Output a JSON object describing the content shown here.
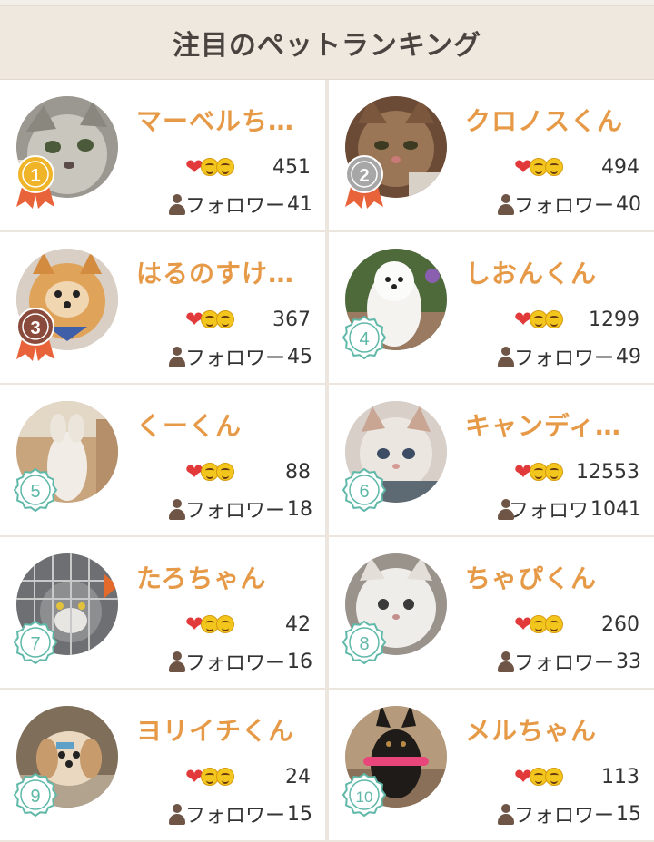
{
  "header": {
    "title": "注目のペットランキング"
  },
  "pets": [
    {
      "rank": "1",
      "name": "マーベルち…",
      "likes": "451",
      "follow_label": "フォロワー",
      "followers": "41",
      "badge": "gold-medal-icon",
      "photo": "gray-tabby-cat"
    },
    {
      "rank": "2",
      "name": "クロノスくん",
      "likes": "494",
      "follow_label": "フォロワー",
      "followers": "40",
      "badge": "silver-medal-icon",
      "photo": "brown-tabby-cat"
    },
    {
      "rank": "3",
      "name": "はるのすけ…",
      "likes": "367",
      "follow_label": "フォロワー",
      "followers": "45",
      "badge": "bronze-medal-icon",
      "photo": "pomeranian-dog"
    },
    {
      "rank": "4",
      "name": "しおんくん",
      "likes": "1299",
      "follow_label": "フォロワー",
      "followers": "49",
      "badge": "rank-seal-icon",
      "photo": "white-spitz-dog"
    },
    {
      "rank": "5",
      "name": "くーくん",
      "likes": "88",
      "follow_label": "フォロワー",
      "followers": "18",
      "badge": "rank-seal-icon",
      "photo": "standing-cat"
    },
    {
      "rank": "6",
      "name": "キャンディ…",
      "likes": "12553",
      "follow_label": "フォロワ",
      "followers": "1041",
      "badge": "rank-seal-icon",
      "photo": "white-kitten"
    },
    {
      "rank": "7",
      "name": "たろちゃん",
      "likes": "42",
      "follow_label": "フォロワー",
      "followers": "16",
      "badge": "rank-seal-icon",
      "photo": "caged-cat"
    },
    {
      "rank": "8",
      "name": "ちゃぴくん",
      "likes": "260",
      "follow_label": "フォロワー",
      "followers": "33",
      "badge": "rank-seal-icon",
      "photo": "fluffy-white-kitten"
    },
    {
      "rank": "9",
      "name": "ヨリイチくん",
      "likes": "24",
      "follow_label": "フォロワー",
      "followers": "15",
      "badge": "rank-seal-icon",
      "photo": "shih-tzu-dog"
    },
    {
      "rank": "10",
      "name": "メルちゃん",
      "likes": "113",
      "follow_label": "フォロワー",
      "followers": "15",
      "badge": "rank-seal-icon",
      "photo": "black-shepherd-puppy"
    }
  ],
  "colors": {
    "name": "#e69a47",
    "gold": "#f0b429",
    "silver": "#a7a7a7",
    "bronze": "#8a4b3c",
    "seal": "#5fb8a8",
    "ribbon": "#e8633a"
  }
}
